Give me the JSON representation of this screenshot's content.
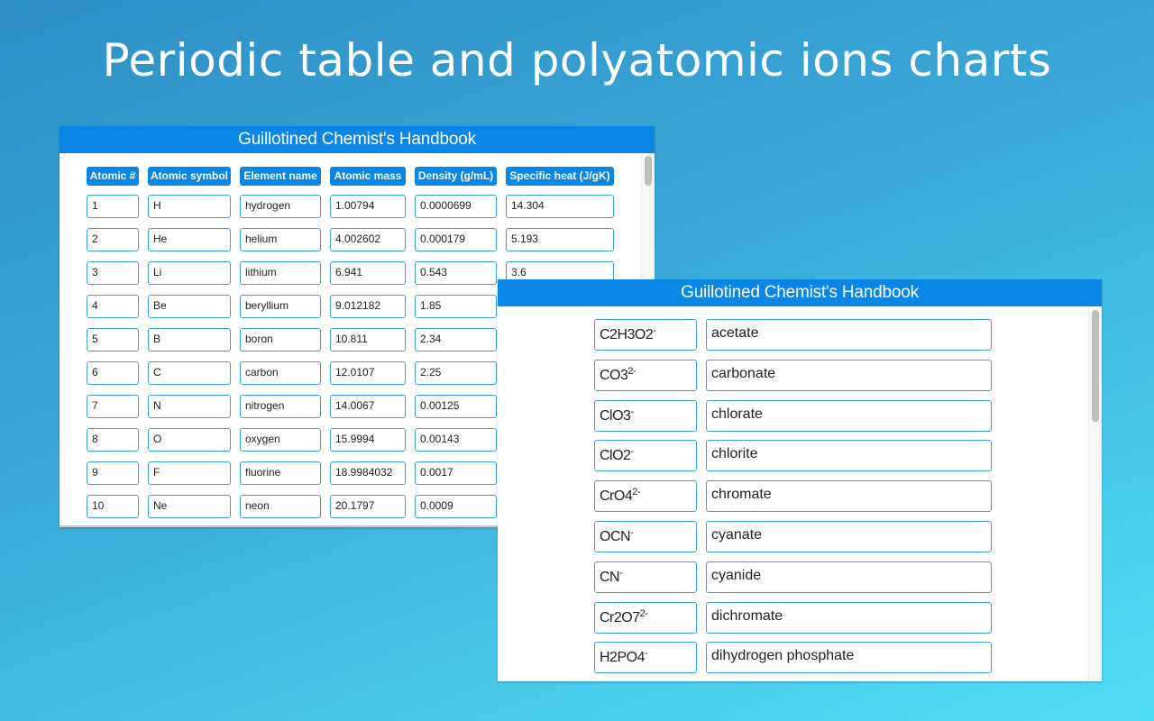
{
  "hero": {
    "title": "Periodic table and polyatomic ions charts"
  },
  "window_periodic": {
    "title": "Guillotined Chemist's Handbook",
    "headers": [
      "Atomic #",
      "Atomic symbol",
      "Element name",
      "Atomic mass",
      "Density (g/mL)",
      "Specific heat (J/gK)"
    ],
    "rows": [
      [
        "1",
        "H",
        "hydrogen",
        "1.00794",
        "0.0000699",
        "14.304"
      ],
      [
        "2",
        "He",
        "helium",
        "4.002602",
        "0.000179",
        "5.193"
      ],
      [
        "3",
        "Li",
        "lithium",
        "6.941",
        "0.543",
        "3.6"
      ],
      [
        "4",
        "Be",
        "beryllium",
        "9.012182",
        "1.85",
        ""
      ],
      [
        "5",
        "B",
        "boron",
        "10.811",
        "2.34",
        ""
      ],
      [
        "6",
        "C",
        "carbon",
        "12.0107",
        "2.25",
        ""
      ],
      [
        "7",
        "N",
        "nitrogen",
        "14.0067",
        "0.00125",
        ""
      ],
      [
        "8",
        "O",
        "oxygen",
        "15.9994",
        "0.00143",
        ""
      ],
      [
        "9",
        "F",
        "fluorine",
        "18.9984032",
        "0.0017",
        ""
      ],
      [
        "10",
        "Ne",
        "neon",
        "20.1797",
        "0.0009",
        ""
      ]
    ]
  },
  "window_ions": {
    "title": "Guillotined Chemist's Handbook",
    "ions": [
      {
        "formula": "C2H3O2",
        "charge": "-",
        "name": "acetate"
      },
      {
        "formula": "CO3",
        "charge": "2-",
        "name": "carbonate"
      },
      {
        "formula": "ClO3",
        "charge": "-",
        "name": "chlorate"
      },
      {
        "formula": "ClO2",
        "charge": "-",
        "name": "chlorite"
      },
      {
        "formula": "CrO4",
        "charge": "2-",
        "name": "chromate"
      },
      {
        "formula": "OCN",
        "charge": "-",
        "name": "cyanate"
      },
      {
        "formula": "CN",
        "charge": "-",
        "name": "cyanide"
      },
      {
        "formula": "Cr2O7",
        "charge": "2-",
        "name": "dichromate"
      },
      {
        "formula": "H2PO4",
        "charge": "-",
        "name": "dihydrogen phosphate"
      }
    ]
  },
  "colors": {
    "accent": "#0a87e6",
    "field_border": "#3d9be0"
  }
}
